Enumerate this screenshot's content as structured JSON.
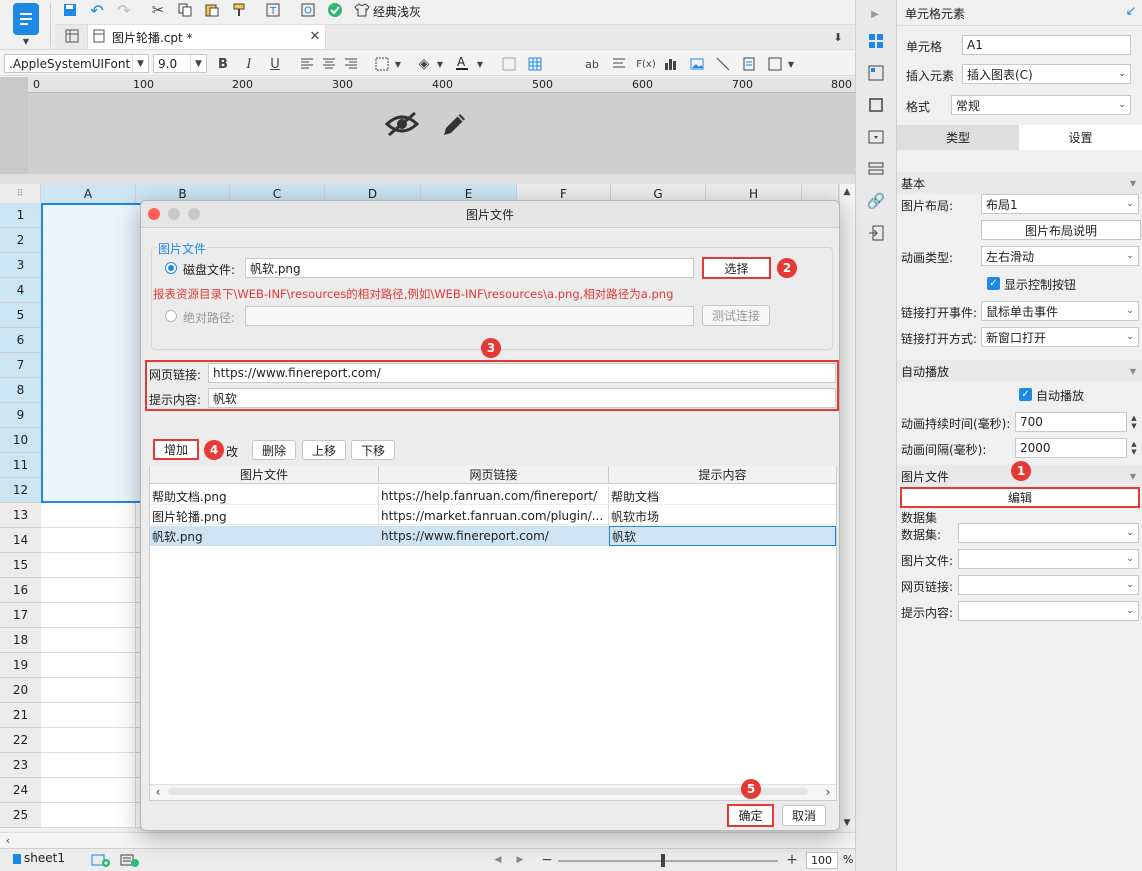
{
  "toolbar": {
    "theme_label": "经典浅灰",
    "font_name": ".AppleSystemUIFont",
    "font_size": "9.0",
    "bold": "B",
    "italic": "I",
    "underline": "U",
    "fx": "F(x)",
    "ab": "ab"
  },
  "tab": {
    "title": "图片轮播.cpt *"
  },
  "ruler": {
    "ticks": [
      "0",
      "100",
      "200",
      "300",
      "400",
      "500",
      "600",
      "700",
      "800"
    ]
  },
  "sheet": {
    "columns": [
      "A",
      "B",
      "C",
      "D",
      "E",
      "F",
      "G",
      "H"
    ],
    "rows": [
      "1",
      "2",
      "3",
      "4",
      "5",
      "6",
      "7",
      "8",
      "9",
      "10",
      "11",
      "12",
      "13",
      "14",
      "15",
      "16",
      "17",
      "18",
      "19",
      "20",
      "21",
      "22",
      "23",
      "24",
      "25"
    ],
    "tab_name": "sheet1",
    "zoom": "100",
    "zoom_unit": "%"
  },
  "dialog": {
    "title": "图片文件",
    "group_label": "图片文件",
    "disk_label": "磁盘文件:",
    "disk_value": "帆软.png",
    "select_btn": "选择",
    "hint": "报表资源目录下\\WEB-INF\\resources的相对路径,例如\\WEB-INF\\resources\\a.png,相对路径为a.png",
    "abs_label": "绝对路径:",
    "test_btn": "测试连接",
    "link_label": "网页链接:",
    "link_value": "https://www.finereport.com/",
    "tip_label": "提示内容:",
    "tip_value": "帆软",
    "add_btn": "增加",
    "edit_btn": "修改",
    "edit_btn_visible": "改",
    "delete_btn": "删除",
    "up_btn": "上移",
    "down_btn": "下移",
    "table_headers": [
      "图片文件",
      "网页链接",
      "提示内容"
    ],
    "table_rows": [
      [
        "帮助文档.png",
        "https://help.fanruan.com/finereport/",
        "帮助文档"
      ],
      [
        "图片轮播.png",
        "https://market.fanruan.com/plugin/...",
        "帆软市场"
      ],
      [
        "帆软.png",
        "https://www.finereport.com/",
        "帆软"
      ]
    ],
    "ok_btn": "确定",
    "cancel_btn": "取消"
  },
  "badges": {
    "b1": "1",
    "b2": "2",
    "b3": "3",
    "b4": "4",
    "b5": "5"
  },
  "panel": {
    "title": "单元格元素",
    "cell_label": "单元格",
    "cell_value": "A1",
    "insert_label": "插入元素",
    "insert_value": "插入图表(C)",
    "format_label": "格式",
    "format_value": "常规",
    "tab_type": "类型",
    "tab_settings": "设置",
    "basic_section": "基本",
    "layout_label": "图片布局:",
    "layout_value": "布局1",
    "layout_help_btn": "图片布局说明",
    "anim_label": "动画类型:",
    "anim_value": "左右滑动",
    "show_ctrl": "显示控制按钮",
    "link_event_label": "链接打开事件:",
    "link_event_value": "鼠标单击事件",
    "link_mode_label": "链接打开方式:",
    "link_mode_value": "新窗口打开",
    "autoplay_section": "自动播放",
    "autoplay_check": "自动播放",
    "duration_label": "动画持续时间(毫秒):",
    "duration_value": "700",
    "interval_label": "动画间隔(毫秒):",
    "interval_value": "2000",
    "imgfile_section": "图片文件",
    "edit_btn": "编辑",
    "dataset_section": "数据集",
    "dataset_label": "数据集:",
    "ds_img_label": "图片文件:",
    "ds_link_label": "网页链接:",
    "ds_tip_label": "提示内容:"
  },
  "colors": {
    "accent": "#1e88e5",
    "highlight": "#e53935",
    "selected_row": "#cfe3f3"
  }
}
